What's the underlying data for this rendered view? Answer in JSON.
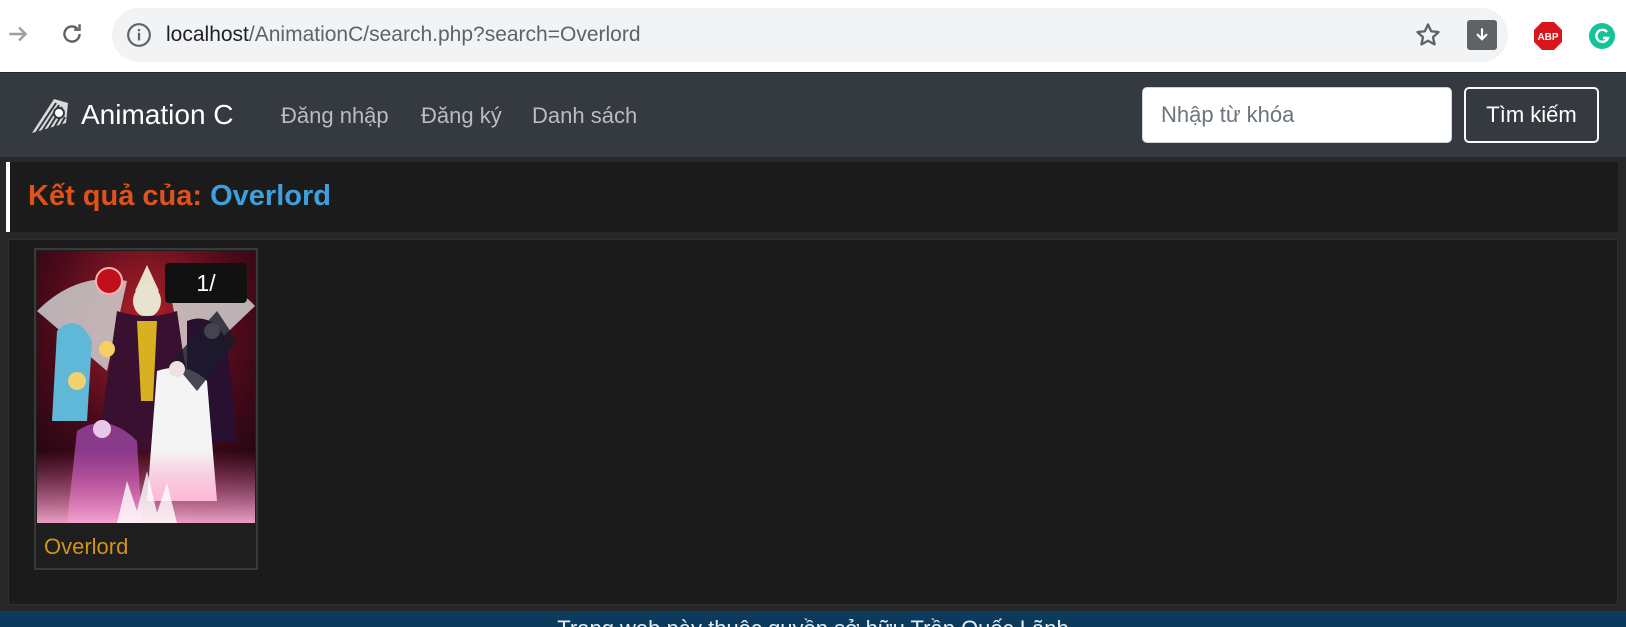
{
  "browser": {
    "url_host": "localhost",
    "url_path": "/AnimationC/search.php?search=Overlord",
    "icons": [
      "back-arrow-icon",
      "reload-icon",
      "info-icon",
      "star-icon",
      "download-icon",
      "adblock-plus-icon",
      "grammarly-icon"
    ],
    "abp_label": "ABP"
  },
  "navbar": {
    "brand": "Animation C",
    "links": [
      "Đăng nhập",
      "Đăng ký",
      "Danh sách"
    ],
    "search_placeholder": "Nhập từ khóa",
    "search_button": "Tìm kiếm"
  },
  "results": {
    "label": "Kết quả của:",
    "query": "Overlord",
    "items": [
      {
        "title": "Overlord",
        "badge": "1/"
      }
    ]
  },
  "footer": {
    "text": "Trang web này thuộc quyền sở hữu Trần Quốc Lãnh"
  },
  "colors": {
    "navbar_bg": "#343a40",
    "page_bg": "#1b1b1b",
    "result_label": "#e0521b",
    "result_query": "#3e9fdc",
    "card_title": "#d4911e",
    "footer_bg": "#0b3a5c"
  }
}
